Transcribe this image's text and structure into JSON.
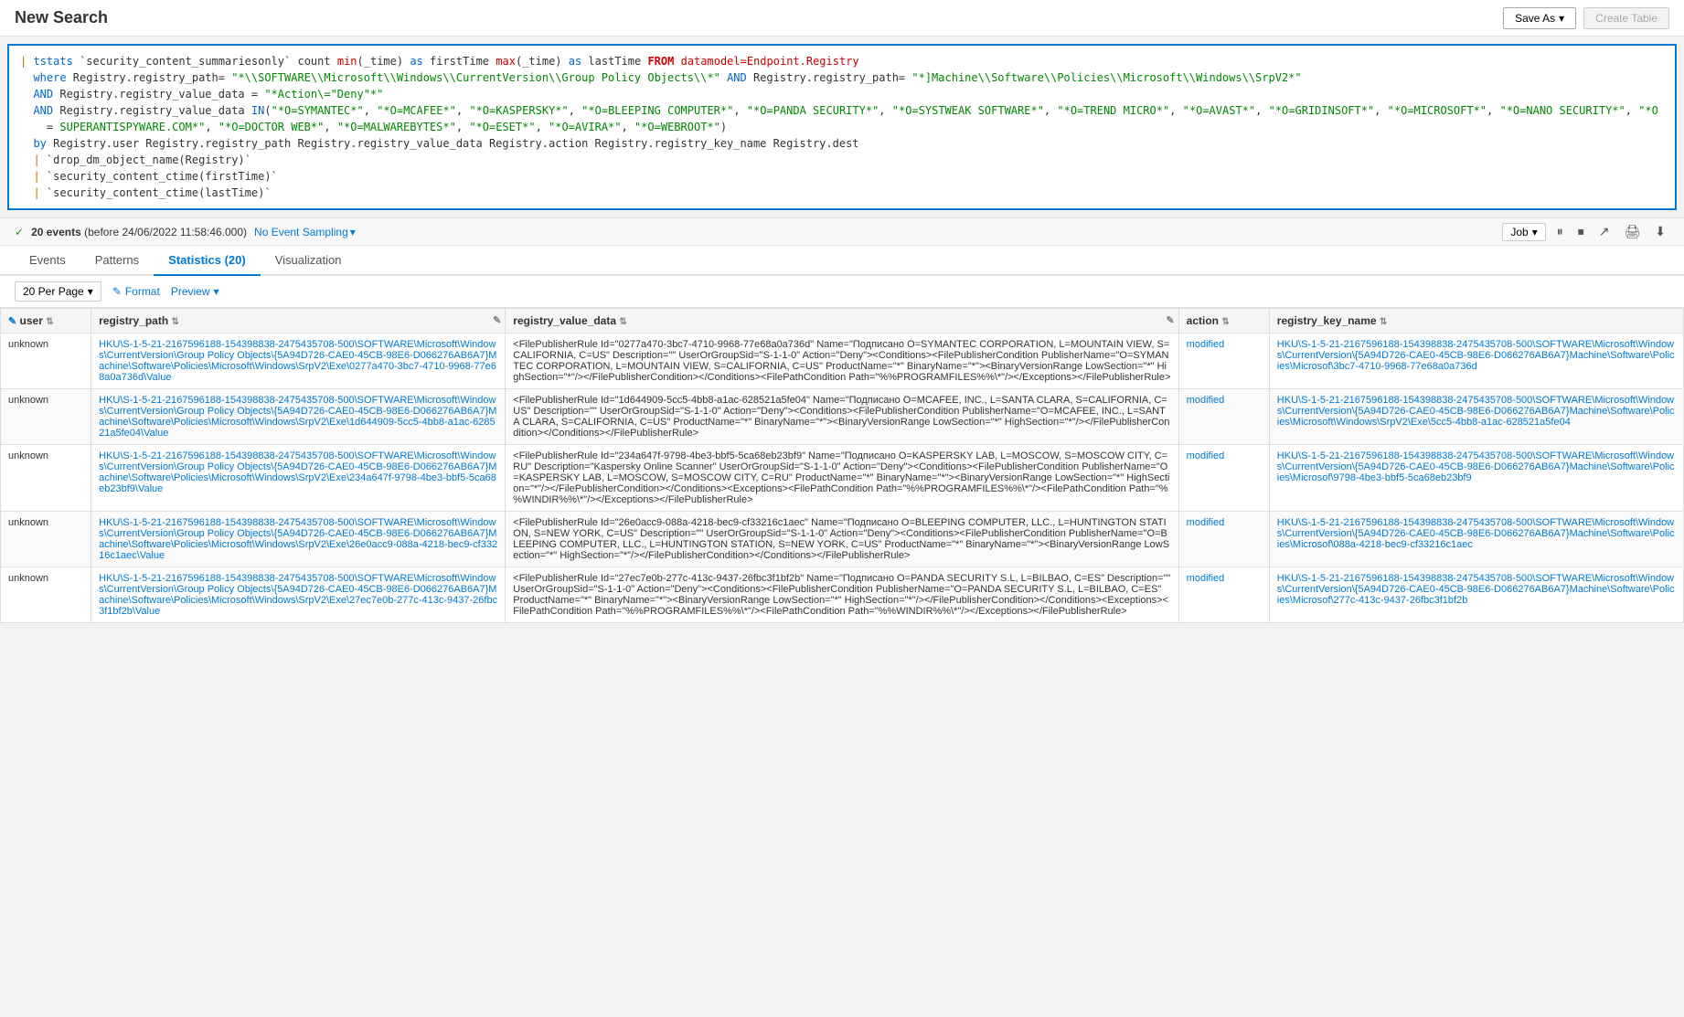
{
  "header": {
    "title": "New Search",
    "save_as_label": "Save As",
    "save_as_dropdown": "▾",
    "create_table_label": "Create Table"
  },
  "query": {
    "line1": "| tstats `security_content_summariesonly` count min(_time) as firstTime max(_time) as lastTime FROM datamodel=Endpoint.Registry",
    "line2": "  where Registry.registry_path= \"*\\\\SOFTWARE\\\\Microsoft\\\\Windows\\\\CurrentVersion\\\\Group Policy Objects\\\\*\" AND Registry.registry_path= \"*]Machine\\\\Software\\\\Policies\\\\Microsoft\\\\Windows\\\\SrpV2*\"",
    "line3": "  AND Registry.registry_value_data = \"*Action\\=\"Deny\"*\"",
    "line4": "  AND Registry.registry_value_data IN(\"*O=SYMANTEC*\", \"*O=MCAFEE*\", \"*O=KASPERSKY*\", \"*O=BLEEPING COMPUTER*\", \"*O=PANDA SECURITY*\", \"*O=SYSTWEAK SOFTWARE*\", \"*O=TREND MICRO*\", \"*O=AVAST*\", \"*O=GRIDINSOFT*\", \"*O=MICROSOFT*\", \"*O=NANO SECURITY*\", \"*O=SUPERANTISPYWARE.COM*\", \"*O=DOCTOR WEB*\", \"*O=MALWAREBYTES*\", \"*O=ESET*\", \"*O=AVIRA*\", \"*O=WEBROOT*\")",
    "line5": "  by Registry.user Registry.registry_path Registry.registry_value_data Registry.action Registry.registry_key_name Registry.dest",
    "line6": "  | `drop_dm_object_name(Registry)`",
    "line7": "  | `security_content_ctime(firstTime)`",
    "line8": "  | `security_content_ctime(lastTime)`"
  },
  "status": {
    "check_icon": "✓",
    "events_text": "20 events",
    "before_text": "(before 24/06/2022 11:58:46.000)",
    "sampling_label": "No Event Sampling",
    "dropdown_icon": "▾",
    "job_label": "Job",
    "job_dropdown": "▾",
    "pause_icon": "⏸",
    "stop_icon": "⏹",
    "share_icon": "↗",
    "print_icon": "🖨",
    "export_icon": "⬇"
  },
  "tabs": [
    {
      "id": "events",
      "label": "Events"
    },
    {
      "id": "patterns",
      "label": "Patterns"
    },
    {
      "id": "statistics",
      "label": "Statistics (20)",
      "active": true
    },
    {
      "id": "visualization",
      "label": "Visualization"
    }
  ],
  "toolbar": {
    "per_page_label": "20 Per Page",
    "per_page_dropdown": "▾",
    "format_label": "Format",
    "format_icon": "✎",
    "preview_label": "Preview",
    "preview_dropdown": "▾"
  },
  "table": {
    "columns": [
      {
        "id": "user",
        "label": "user",
        "sortable": true,
        "editable": false
      },
      {
        "id": "registry_path",
        "label": "registry_path",
        "sortable": true,
        "editable": true
      },
      {
        "id": "registry_value_data",
        "label": "registry_value_data",
        "sortable": true,
        "editable": true
      },
      {
        "id": "action",
        "label": "action",
        "sortable": true,
        "editable": false
      },
      {
        "id": "registry_key_name",
        "label": "registry_key_name",
        "sortable": true,
        "editable": false
      }
    ],
    "rows": [
      {
        "user": "unknown",
        "registry_path": "HKU\\S-1-5-21-2167596188-154398838-2475435708-500\\SOFTWARE\\Microsoft\\Windows\\CurrentVersion\\Group Policy Objects\\{5A94D726-CAE0-45CB-98E6-D066276AB6A7}Machine\\Software\\Policies\\Microsoft\\Windows\\SrpV2\\Exe\\0277a470-3bc7-4710-9968-77e68a0a736d\\Value",
        "registry_value_data": "&lt;FilePublisherRule Id=\"0277a470-3bc7-4710-9968-77e68a0a736d\" Name=\"Подписано O=SYMANTEC CORPORATION, L=MOUNTAIN VIEW, S=CALIFORNIA, C=US\" Description=\"\" UserOrGroupSid=\"S-1-1-0\" Action=\"Deny\"&gt;&lt;Conditions&gt;&lt;FilePublisherCondition PublisherName=\"O=SYMANTEC CORPORATION, L=MOUNTAIN VIEW, S=CALIFORNIA, C=US\" ProductName=\"*\" BinaryName=\"*\"&gt;&lt;BinaryVersionRange LowSection=\"*\" HighSection=\"*\"/&gt;&lt;/FilePublisherCondition&gt;&lt;/Conditions&gt;&lt;FilePathCondition Path=\"%%PROGRAMFILES%%\\*\"/&gt;&lt;/Exceptions&gt;&lt;/FilePublisherRule&gt;",
        "action": "modified",
        "registry_key_name": "HKU\\S-1-5-21-2167596188-154398838-2475435708-500\\SOFTWARE\\Microsoft\\Windows\\CurrentVersion\\{5A94D726-CAE0-45CB-98E6-D066276AB6A7}Machine\\Software\\Policies\\Microsof\\3bc7-4710-9968-77e68a0a736d"
      },
      {
        "user": "unknown",
        "registry_path": "HKU\\S-1-5-21-2167596188-154398838-2475435708-500\\SOFTWARE\\Microsoft\\Windows\\CurrentVersion\\Group Policy Objects\\{5A94D726-CAE0-45CB-98E6-D066276AB6A7}Machine\\Software\\Policies\\Microsoft\\Windows\\SrpV2\\Exe\\1d644909-5cc5-4bb8-a1ac-628521a5fe04\\Value",
        "registry_value_data": "&lt;FilePublisherRule Id=\"1d644909-5cc5-4bb8-a1ac-628521a5fe04\" Name=\"Подписано O=MCAFEE, INC., L=SANTA CLARA, S=CALIFORNIA, C=US\" Description=\"\" UserOrGroupSid=\"S-1-1-0\" Action=\"Deny\"&gt;&lt;Conditions&gt;&lt;FilePublisherCondition PublisherName=\"O=MCAFEE, INC., L=SANTA CLARA, S=CALIFORNIA, C=US\" ProductName=\"*\" BinaryName=\"*\"&gt;&lt;BinaryVersionRange LowSection=\"*\" HighSection=\"*\"/&gt;&lt;/FilePublisherCondition&gt;&lt;/Conditions&gt;&lt;/FilePublisherRule&gt;",
        "action": "modified",
        "registry_key_name": "HKU\\S-1-5-21-2167596188-154398838-2475435708-500\\SOFTWARE\\Microsoft\\Windows\\CurrentVersion\\{5A94D726-CAE0-45CB-98E6-D066276AB6A7}Machine\\Software\\Policies\\Microsoft\\Windows\\SrpV2\\Exe\\5cc5-4bb8-a1ac-628521a5fe04"
      },
      {
        "user": "unknown",
        "registry_path": "HKU\\S-1-5-21-2167596188-154398838-2475435708-500\\SOFTWARE\\Microsoft\\Windows\\CurrentVersion\\Group Policy Objects\\{5A94D726-CAE0-45CB-98E6-D066276AB6A7}Machine\\Software\\Policies\\Microsoft\\Windows\\SrpV2\\Exe\\234a647f-9798-4be3-bbf5-5ca68eb23bf9\\Value",
        "registry_value_data": "&lt;FilePublisherRule Id=\"234a647f-9798-4be3-bbf5-5ca68eb23bf9\" Name=\"Подписано O=KASPERSKY LAB, L=MOSCOW, S=MOSCOW CITY, C=RU\" Description=\"Kaspersky Online Scanner\" UserOrGroupSid=\"S-1-1-0\" Action=\"Deny\"&gt;&lt;Conditions&gt;&lt;FilePublisherCondition PublisherName=\"O=KASPERSKY LAB, L=MOSCOW, S=MOSCOW CITY, C=RU\" ProductName=\"*\" BinaryName=\"*\"&gt;&lt;BinaryVersionRange LowSection=\"*\" HighSection=\"*\"/&gt;&lt;/FilePublisherCondition&gt;&lt;/Conditions&gt;&lt;Exceptions&gt;&lt;FilePathCondition Path=\"%%PROGRAMFILES%%\\*\"/&gt;&lt;FilePathCondition Path=\"%%WINDIR%%\\*\"/&gt;&lt;/Exceptions&gt;&lt;/FilePublisherRule&gt;",
        "action": "modified",
        "registry_key_name": "HKU\\S-1-5-21-2167596188-154398838-2475435708-500\\SOFTWARE\\Microsoft\\Windows\\CurrentVersion\\{5A94D726-CAE0-45CB-98E6-D066276AB6A7}Machine\\Software\\Policies\\Microsof\\9798-4be3-bbf5-5ca68eb23bf9"
      },
      {
        "user": "unknown",
        "registry_path": "HKU\\S-1-5-21-2167596188-154398838-2475435708-500\\SOFTWARE\\Microsoft\\Windows\\CurrentVersion\\Group Policy Objects\\{5A94D726-CAE0-45CB-98E6-D066276AB6A7}Machine\\Software\\Policies\\Microsoft\\Windows\\SrpV2\\Exe\\26e0acc9-088a-4218-bec9-cf33216c1aec\\Value",
        "registry_value_data": "&lt;FilePublisherRule Id=\"26e0acc9-088a-4218-bec9-cf33216c1aec\" Name=\"Подписано O=BLEEPING COMPUTER, LLC., L=HUNTINGTON STATION, S=NEW YORK, C=US\" Description=\"\" UserOrGroupSid=\"S-1-1-0\" Action=\"Deny\"&gt;&lt;Conditions&gt;&lt;FilePublisherCondition PublisherName=\"O=BLEEPING COMPUTER, LLC., L=HUNTINGTON STATION, S=NEW YORK, C=US\" ProductName=\"*\" BinaryName=\"*\"&gt;&lt;BinaryVersionRange LowSection=\"*\" HighSection=\"*\"/&gt;&lt;/FilePublisherCondition&gt;&lt;/Conditions&gt;&lt;/FilePublisherRule&gt;",
        "action": "modified",
        "registry_key_name": "HKU\\S-1-5-21-2167596188-154398838-2475435708-500\\SOFTWARE\\Microsoft\\Windows\\CurrentVersion\\{5A94D726-CAE0-45CB-98E6-D066276AB6A7}Machine\\Software\\Policies\\Microsof\\088a-4218-bec9-cf33216c1aec"
      },
      {
        "user": "unknown",
        "registry_path": "HKU\\S-1-5-21-2167596188-154398838-2475435708-500\\SOFTWARE\\Microsoft\\Windows\\CurrentVersion\\Group Policy Objects\\{5A94D726-CAE0-45CB-98E6-D066276AB6A7}Machine\\Software\\Policies\\Microsoft\\Windows\\SrpV2\\Exe\\27ec7e0b-277c-413c-9437-26fbc3f1bf2b\\Value",
        "registry_value_data": "&lt;FilePublisherRule Id=\"27ec7e0b-277c-413c-9437-26fbc3f1bf2b\" Name=\"Подписано O=PANDA SECURITY S.L, L=BILBAO, C=ES\" Description=\"\" UserOrGroupSid=\"S-1-1-0\" Action=\"Deny\"&gt;&lt;Conditions&gt;&lt;FilePublisherCondition PublisherName=\"O=PANDA SECURITY S.L, L=BILBAO, C=ES\" ProductName=\"*\" BinaryName=\"*\"&gt;&lt;BinaryVersionRange LowSection=\"*\" HighSection=\"*\"/&gt;&lt;/FilePublisherCondition&gt;&lt;/Conditions&gt;&lt;Exceptions&gt;&lt;FilePathCondition Path=\"%%PROGRAMFILES%%\\*\"/&gt;&lt;FilePathCondition Path=\"%%WINDIR%%\\*\"/&gt;&lt;/Exceptions&gt;&lt;/FilePublisherRule&gt;",
        "action": "modified",
        "registry_key_name": "HKU\\S-1-5-21-2167596188-154398838-2475435708-500\\SOFTWARE\\Microsoft\\Windows\\CurrentVersion\\{5A94D726-CAE0-45CB-98E6-D066276AB6A7}Machine\\Software\\Policies\\Microsof\\277c-413c-9437-26fbc3f1bf2b"
      }
    ]
  }
}
